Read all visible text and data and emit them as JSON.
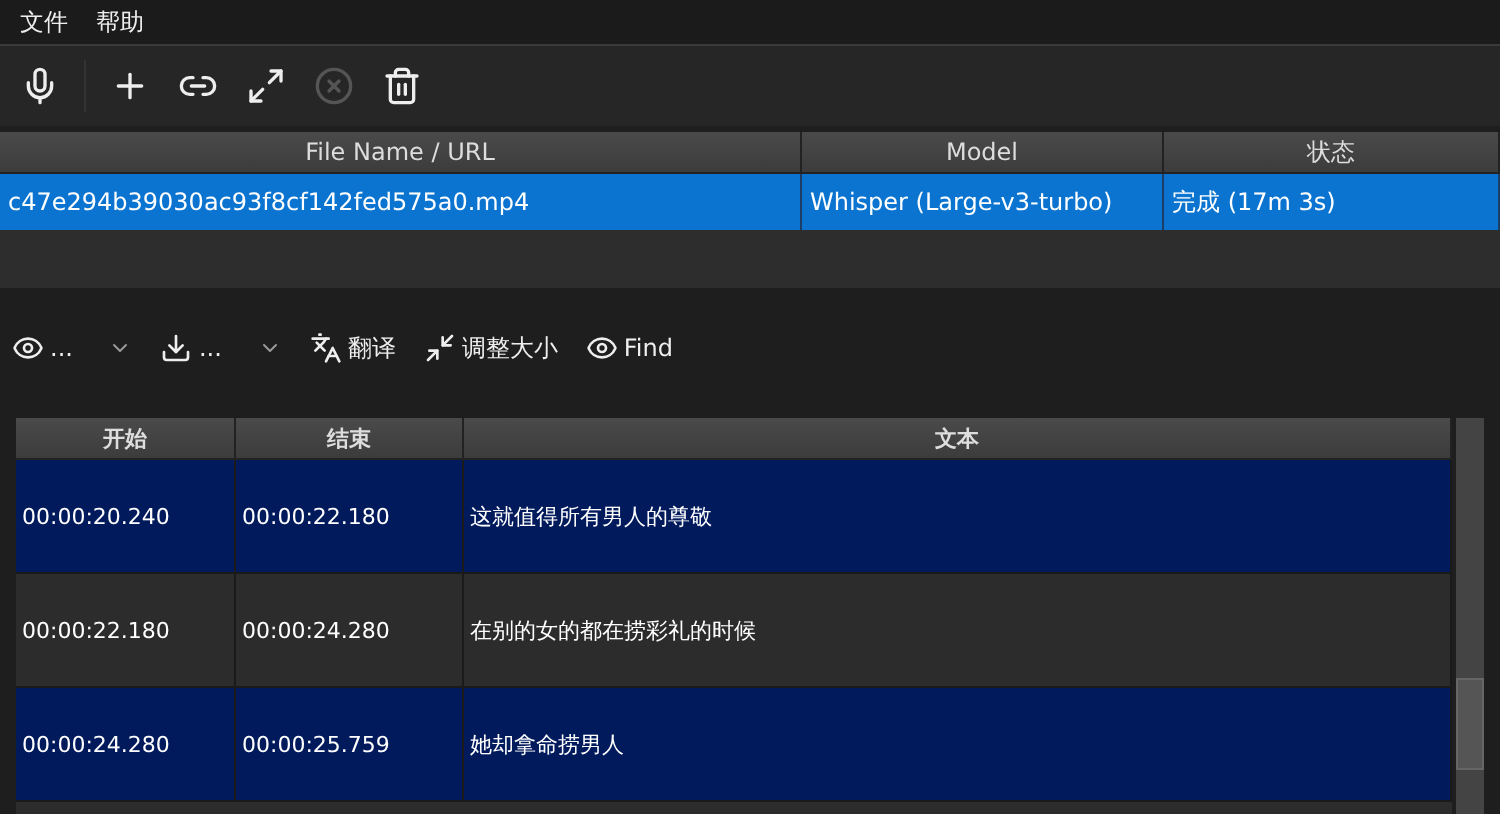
{
  "menu": [
    "文件",
    "帮助"
  ],
  "toolbar": [
    {
      "kind": "mic",
      "disabled": false
    },
    {
      "kind": "sep"
    },
    {
      "kind": "plus",
      "disabled": false
    },
    {
      "kind": "link",
      "disabled": false
    },
    {
      "kind": "expand",
      "disabled": false
    },
    {
      "kind": "cancel",
      "disabled": true
    },
    {
      "kind": "trash",
      "disabled": false
    }
  ],
  "files": {
    "columns": [
      "File Name / URL",
      "Model",
      "状态"
    ],
    "rows": [
      {
        "cells": [
          "c47e294b39030ac93f8cf142fed575a0.mp4",
          "Whisper (Large-v3-turbo)",
          "完成 (17m 3s)"
        ],
        "selected": true
      }
    ]
  },
  "actions": [
    {
      "kind": "view",
      "label": "...",
      "dropdown": true
    },
    {
      "kind": "download",
      "label": "...",
      "dropdown": true
    },
    {
      "kind": "translate",
      "label": "翻译",
      "dropdown": false
    },
    {
      "kind": "shrink",
      "label": "调整大小",
      "dropdown": false
    },
    {
      "kind": "view",
      "label": "Find",
      "dropdown": false
    }
  ],
  "subtitles": {
    "columns": [
      "开始",
      "结束",
      "文本"
    ],
    "rows": [
      {
        "cells": [
          "00:00:20.240",
          "00:00:22.180",
          "这就值得所有男人的尊敬"
        ],
        "selected": true
      },
      {
        "cells": [
          "00:00:22.180",
          "00:00:24.280",
          "在别的女的都在捞彩礼的时候"
        ],
        "selected": false
      },
      {
        "cells": [
          "00:00:24.280",
          "00:00:25.759",
          "她却拿命捞男人"
        ],
        "selected": true
      }
    ]
  }
}
